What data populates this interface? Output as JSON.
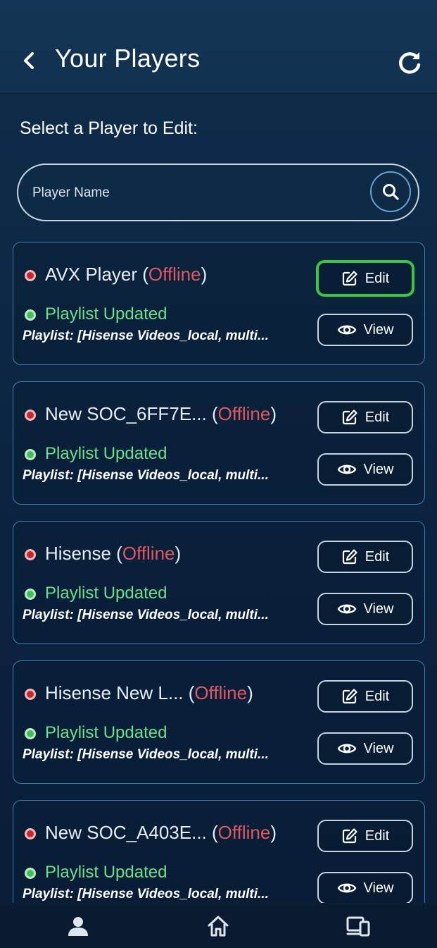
{
  "header": {
    "title": "Your Players"
  },
  "select_label": "Select a Player to Edit:",
  "search": {
    "placeholder": "Player Name"
  },
  "buttons": {
    "edit": "Edit",
    "view": "View"
  },
  "players": [
    {
      "name": "AVX Player",
      "status": "Offline",
      "playlist_status": "Playlist Updated",
      "playlist": "Playlist: [Hisense Videos_local, multi..."
    },
    {
      "name": "New SOC_6FF7E...",
      "status": "Offline",
      "playlist_status": "Playlist Updated",
      "playlist": "Playlist: [Hisense Videos_local, multi..."
    },
    {
      "name": "Hisense",
      "status": "Offline",
      "playlist_status": "Playlist Updated",
      "playlist": "Playlist: [Hisense Videos_local, multi..."
    },
    {
      "name": "Hisense New L...",
      "status": "Offline",
      "playlist_status": "Playlist Updated",
      "playlist": "Playlist: [Hisense Videos_local, multi..."
    },
    {
      "name": "New SOC_A403E...",
      "status": "Offline",
      "playlist_status": "Playlist Updated",
      "playlist": "Playlist: [Hisense Videos_local, multi..."
    }
  ],
  "colors": {
    "offline": "#e05861",
    "updated": "#6fe08b",
    "highlight": "#35c840",
    "card_border": "#3f7fb3"
  },
  "icons": {
    "back": "chevron-left-icon",
    "refresh": "refresh-icon",
    "search": "search-icon",
    "edit": "edit-icon",
    "view": "eye-icon",
    "profile": "user-icon",
    "home": "home-icon",
    "devices": "devices-icon"
  }
}
